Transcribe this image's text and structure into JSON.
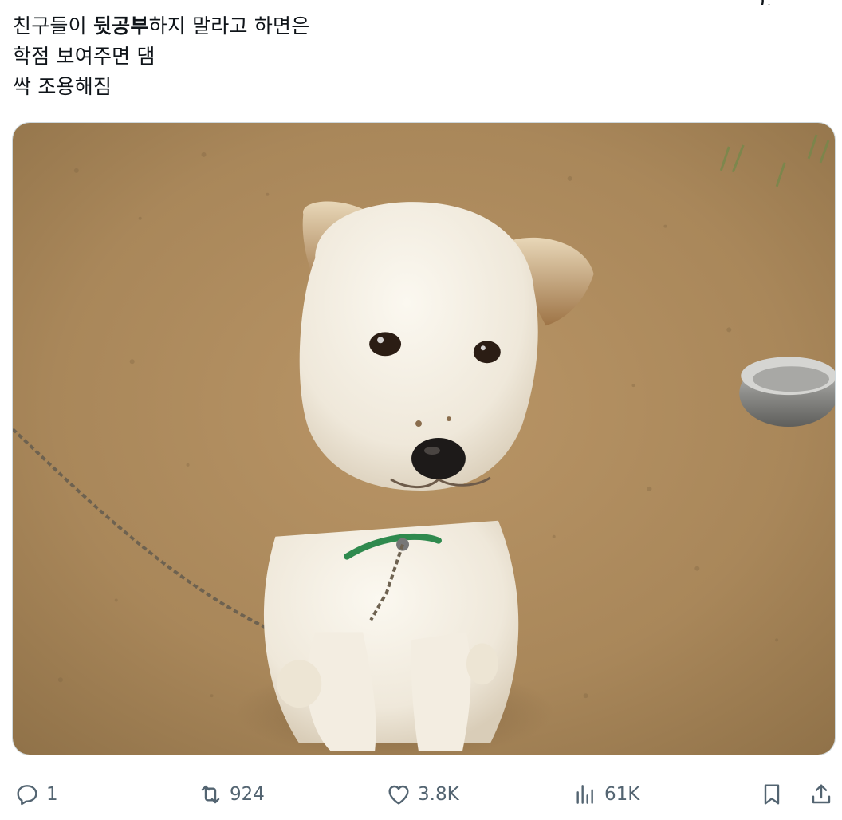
{
  "tweet": {
    "lines": [
      {
        "before": "친구들이 ",
        "bold": "뒷공부",
        "after": "하지 말라고 하면은"
      },
      {
        "text": "학점 보여주면 댐"
      },
      {
        "text": "싹 조용해짐"
      }
    ],
    "top_fragment": "),"
  },
  "media": {
    "icon": "photo-of-white-puppy"
  },
  "actions": {
    "reply_count": "1",
    "retweet_count": "924",
    "like_count": "3.8K",
    "views_count": "61K"
  },
  "colors": {
    "text": "#0f1419",
    "muted": "#536471",
    "border": "#cfd9de"
  }
}
